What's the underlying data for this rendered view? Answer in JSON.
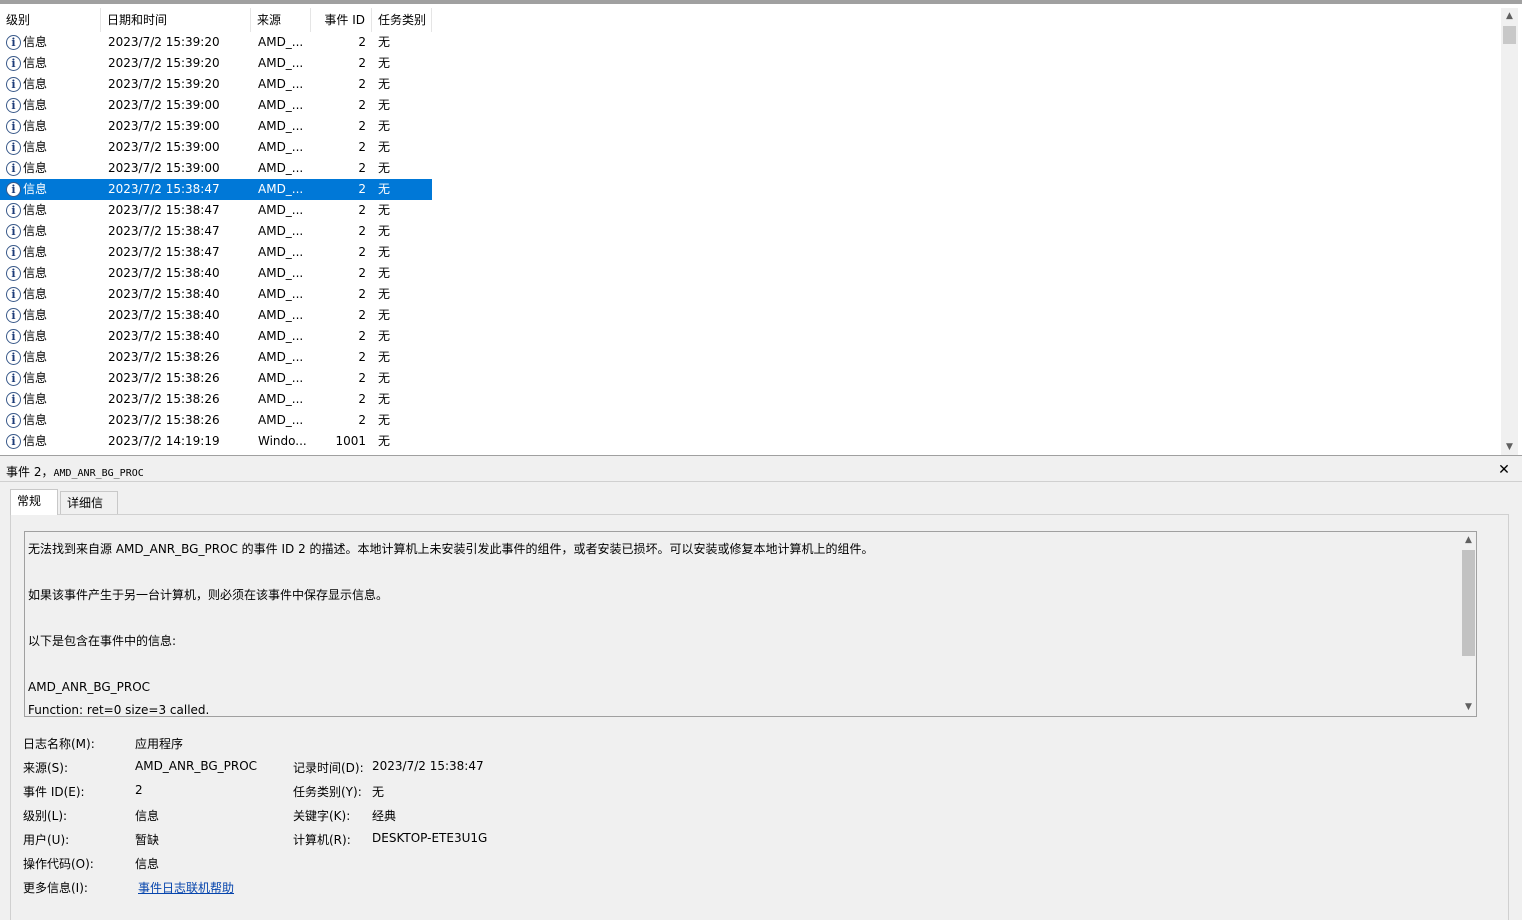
{
  "columns": {
    "level": "级别",
    "datetime": "日期和时间",
    "source": "来源",
    "event_id": "事件 ID",
    "task": "任务类别"
  },
  "events": [
    {
      "level": "信息",
      "datetime": "2023/7/2 15:39:20",
      "source": "AMD_...",
      "event_id": "2",
      "task": "无"
    },
    {
      "level": "信息",
      "datetime": "2023/7/2 15:39:20",
      "source": "AMD_...",
      "event_id": "2",
      "task": "无"
    },
    {
      "level": "信息",
      "datetime": "2023/7/2 15:39:20",
      "source": "AMD_...",
      "event_id": "2",
      "task": "无"
    },
    {
      "level": "信息",
      "datetime": "2023/7/2 15:39:00",
      "source": "AMD_...",
      "event_id": "2",
      "task": "无"
    },
    {
      "level": "信息",
      "datetime": "2023/7/2 15:39:00",
      "source": "AMD_...",
      "event_id": "2",
      "task": "无"
    },
    {
      "level": "信息",
      "datetime": "2023/7/2 15:39:00",
      "source": "AMD_...",
      "event_id": "2",
      "task": "无"
    },
    {
      "level": "信息",
      "datetime": "2023/7/2 15:39:00",
      "source": "AMD_...",
      "event_id": "2",
      "task": "无"
    },
    {
      "level": "信息",
      "datetime": "2023/7/2 15:38:47",
      "source": "AMD_...",
      "event_id": "2",
      "task": "无",
      "selected": true
    },
    {
      "level": "信息",
      "datetime": "2023/7/2 15:38:47",
      "source": "AMD_...",
      "event_id": "2",
      "task": "无"
    },
    {
      "level": "信息",
      "datetime": "2023/7/2 15:38:47",
      "source": "AMD_...",
      "event_id": "2",
      "task": "无"
    },
    {
      "level": "信息",
      "datetime": "2023/7/2 15:38:47",
      "source": "AMD_...",
      "event_id": "2",
      "task": "无"
    },
    {
      "level": "信息",
      "datetime": "2023/7/2 15:38:40",
      "source": "AMD_...",
      "event_id": "2",
      "task": "无"
    },
    {
      "level": "信息",
      "datetime": "2023/7/2 15:38:40",
      "source": "AMD_...",
      "event_id": "2",
      "task": "无"
    },
    {
      "level": "信息",
      "datetime": "2023/7/2 15:38:40",
      "source": "AMD_...",
      "event_id": "2",
      "task": "无"
    },
    {
      "level": "信息",
      "datetime": "2023/7/2 15:38:40",
      "source": "AMD_...",
      "event_id": "2",
      "task": "无"
    },
    {
      "level": "信息",
      "datetime": "2023/7/2 15:38:26",
      "source": "AMD_...",
      "event_id": "2",
      "task": "无"
    },
    {
      "level": "信息",
      "datetime": "2023/7/2 15:38:26",
      "source": "AMD_...",
      "event_id": "2",
      "task": "无"
    },
    {
      "level": "信息",
      "datetime": "2023/7/2 15:38:26",
      "source": "AMD_...",
      "event_id": "2",
      "task": "无"
    },
    {
      "level": "信息",
      "datetime": "2023/7/2 15:38:26",
      "source": "AMD_...",
      "event_id": "2",
      "task": "无"
    },
    {
      "level": "信息",
      "datetime": "2023/7/2 14:19:19",
      "source": "Windo...",
      "event_id": "1001",
      "task": "无"
    }
  ],
  "icons": {
    "info": "i"
  },
  "detail": {
    "title_prefix": "事件 2，",
    "title_source": "AMD_ANR_BG_PROC",
    "close": "✕",
    "tabs": {
      "general": "常规",
      "details": "详细信息"
    },
    "description": [
      "无法找到来自源 AMD_ANR_BG_PROC 的事件 ID 2 的描述。本地计算机上未安装引发此事件的组件，或者安装已损坏。可以安装或修复本地计算机上的组件。",
      "",
      "如果该事件产生于另一台计算机，则必须在该事件中保存显示信息。",
      "",
      "以下是包含在事件中的信息:",
      "",
      "AMD_ANR_BG_PROC",
      "Function: ret=0 size=3 called."
    ],
    "fields": {
      "log_name_label": "日志名称(M):",
      "log_name": "应用程序",
      "source_label": "来源(S):",
      "source": "AMD_ANR_BG_PROC",
      "logged_label": "记录时间(D):",
      "logged": "2023/7/2 15:38:47",
      "event_id_label": "事件 ID(E):",
      "event_id": "2",
      "task_label": "任务类别(Y):",
      "task": "无",
      "level_label": "级别(L):",
      "level": "信息",
      "keywords_label": "关键字(K):",
      "keywords": "经典",
      "user_label": "用户(U):",
      "user": "暂缺",
      "computer_label": "计算机(R):",
      "computer": "DESKTOP-ETE3U1G",
      "opcode_label": "操作代码(O):",
      "opcode": "信息",
      "more_info_label": "更多信息(I):",
      "more_info_link": "事件日志联机帮助"
    }
  },
  "scroll": {
    "up": "▲",
    "down": "▼"
  },
  "colors": {
    "selection": "#0078d7",
    "link": "#0645ad"
  }
}
